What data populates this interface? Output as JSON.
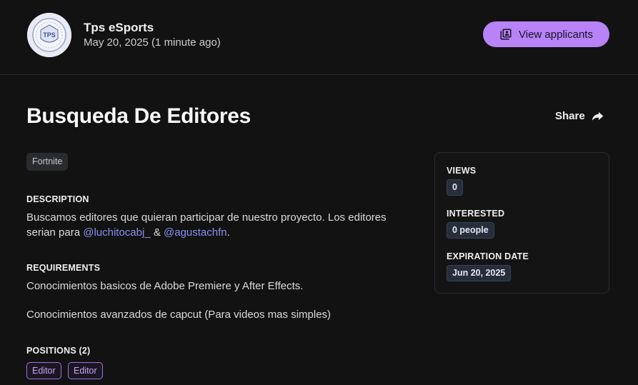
{
  "header": {
    "org_name": "Tps eSports",
    "post_date": "May 20, 2025 (1 minute ago)",
    "applicants_label": "View applicants",
    "logo_text": "TPS"
  },
  "post": {
    "title": "Busqueda De Editores",
    "share_label": "Share",
    "game_tag": "Fortnite",
    "description_label": "DESCRIPTION",
    "description_line1": "Buscamos editores que quieran participar de nuestro proyecto. Los editores",
    "description_prefix": "serian para ",
    "mention1": "@luchitocabj_",
    "description_connector": " & ",
    "mention2": "@agustachfn",
    "description_suffix": ".",
    "requirements_label": "REQUIREMENTS",
    "requirements": [
      "Conocimientos basicos de Adobe Premiere y After Effects.",
      "Conocimientos avanzados de capcut (Para videos mas simples)"
    ],
    "positions_label": "POSITIONS (2)",
    "positions": [
      "Editor",
      "Editor"
    ]
  },
  "stats": {
    "views_label": "VIEWS",
    "views_value": "0",
    "interested_label": "INTERESTED",
    "interested_value": "0 people",
    "expiration_label": "EXPIRATION DATE",
    "expiration_value": "Jun 20, 2025"
  },
  "colors": {
    "background": "#121212",
    "accent": "#b783f7",
    "mention": "#8a8ff2",
    "chip": "#262d3b"
  }
}
